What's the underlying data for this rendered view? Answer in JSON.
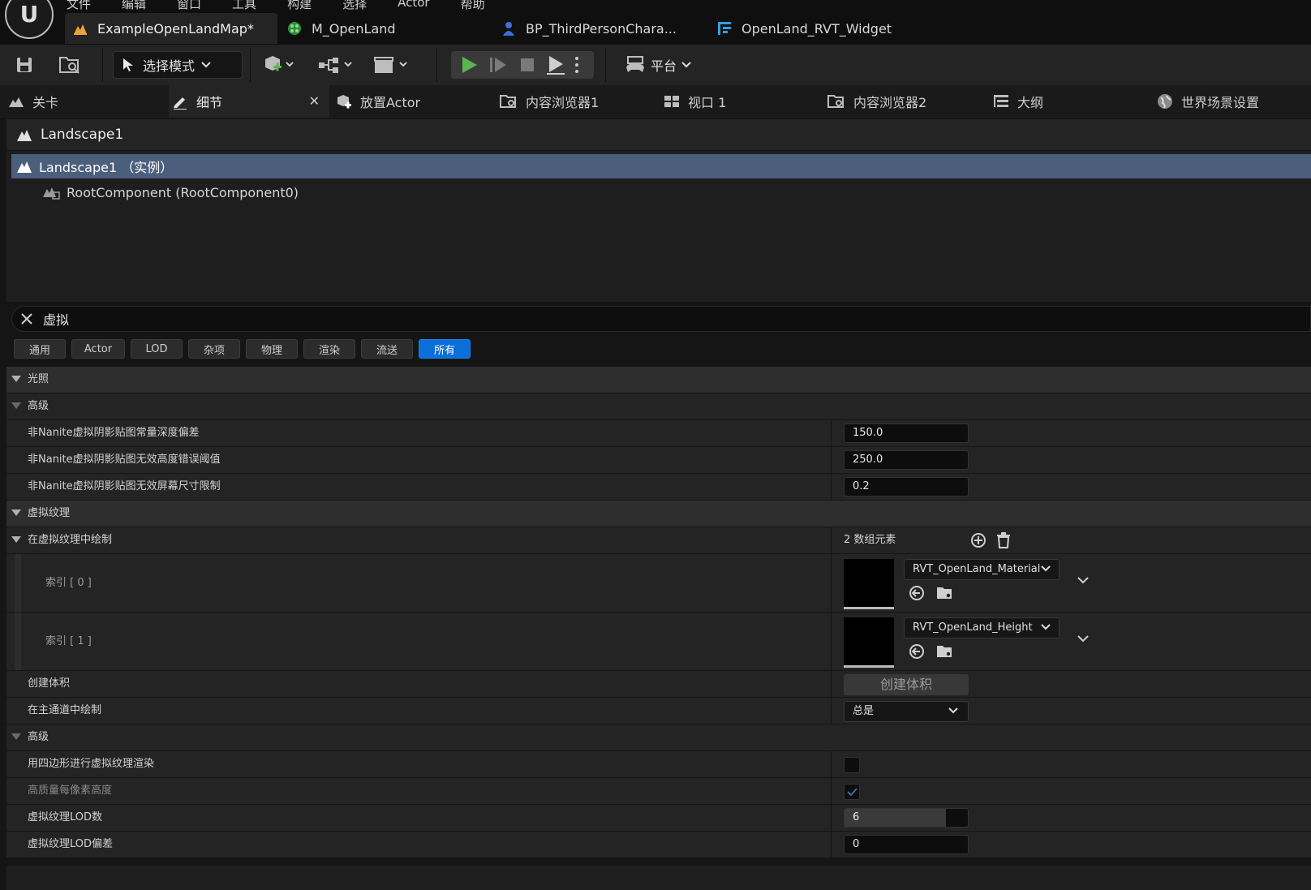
{
  "menu": [
    "文件",
    "编辑",
    "窗口",
    "工具",
    "构建",
    "选择",
    "Actor",
    "帮助"
  ],
  "doc_tabs": [
    {
      "label": "ExampleOpenLandMap*",
      "icon": "level-icon",
      "active": true
    },
    {
      "label": "M_OpenLand",
      "icon": "material-icon"
    },
    {
      "label": "BP_ThirdPersonChara...",
      "icon": "blueprint-icon"
    },
    {
      "label": "OpenLand_RVT_Widget",
      "icon": "widget-icon"
    }
  ],
  "toolbar": {
    "mode_label": "选择模式",
    "platform_label": "平台"
  },
  "panel_tabs": {
    "level": "关卡",
    "details": "细节",
    "place_actor": "放置Actor",
    "content_browser_1": "内容浏览器1",
    "viewport_1": "视口 1",
    "content_browser_2": "内容浏览器2",
    "outliner": "大纲",
    "world_settings": "世界场景设置"
  },
  "details": {
    "actor_name": "Landscape1",
    "instance_row": "Landscape1 （实例）",
    "root_component": "RootComponent (RootComponent0)",
    "search_value": "虚拟"
  },
  "filters": [
    {
      "label": "通用"
    },
    {
      "label": "Actor"
    },
    {
      "label": "LOD"
    },
    {
      "label": "杂项"
    },
    {
      "label": "物理"
    },
    {
      "label": "渲染"
    },
    {
      "label": "流送"
    },
    {
      "label": "所有",
      "active": true
    }
  ],
  "properties": {
    "cat_lighting": "光照",
    "sub_advanced": "高级",
    "p1_name": "非Nanite虚拟阴影贴图常量深度偏差",
    "p1_value": "150.0",
    "p2_name": "非Nanite虚拟阴影贴图无效高度错误阈值",
    "p2_value": "250.0",
    "p3_name": "非Nanite虚拟阴影贴图无效屏幕尺寸限制",
    "p3_value": "0.2",
    "cat_vt": "虚拟纹理",
    "vt_draw_name": "在虚拟纹理中绘制",
    "vt_draw_count": "2 数组元素",
    "idx0_name": "索引 [ 0 ]",
    "idx0_asset": "RVT_OpenLand_Material",
    "idx1_name": "索引 [ 1 ]",
    "idx1_asset": "RVT_OpenLand_Height",
    "create_volume_name": "创建体积",
    "create_volume_button": "创建体积",
    "main_pass_name": "在主通道中绘制",
    "main_pass_value": "总是",
    "sub_advanced_2": "高级",
    "quad_name": "用四边形进行虚拟纹理渲染",
    "quad_checked": false,
    "hq_height_name": "高质量每像素高度",
    "hq_height_checked": true,
    "lod_count_name": "虚拟纹理LOD数",
    "lod_count_value": "6",
    "lod_count_fraction": 0.82,
    "lod_bias_name": "虚拟纹理LOD偏差",
    "lod_bias_value": "0"
  },
  "colors": {
    "accent": "#0a6fd9",
    "play_green": "#5bb450",
    "selection": "#4b5f7c"
  }
}
